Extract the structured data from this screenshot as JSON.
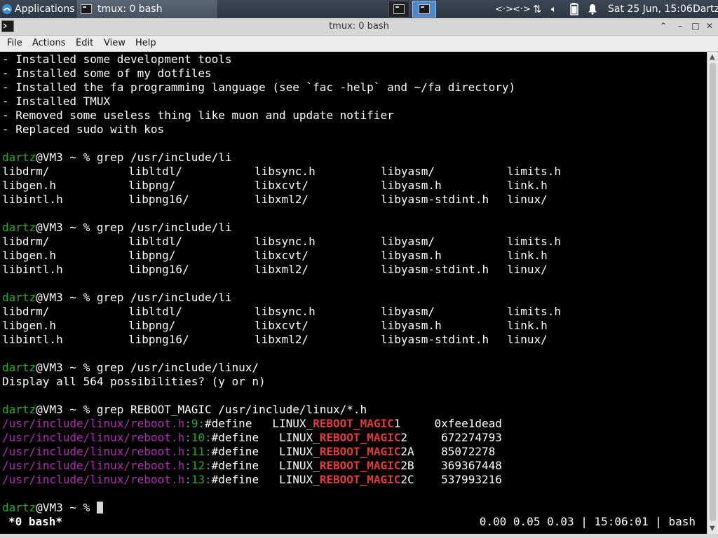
{
  "panel": {
    "applications": "Applications",
    "task_title": "tmux: 0 bash",
    "clock": "Sat 25 Jun, 15:06",
    "user": "Dartz",
    "tray_icons": [
      "network-icon",
      "network-icon",
      "transfer-icon",
      "volume-icon",
      "battery-icon",
      "notification-bell-icon"
    ]
  },
  "window": {
    "title": "tmux: 0 bash",
    "menus": [
      "File",
      "Actions",
      "Edit",
      "View",
      "Help"
    ]
  },
  "colors": {
    "prompt": "#27a827",
    "path": "#b02ab0",
    "linenum": "#27a8a8",
    "match": "#e23a3a"
  },
  "terminal": {
    "notes": [
      "- Installed some development tools",
      "- Installed some of my dotfiles",
      "- Installed the fa programming language (see `fac -help` and ~/fa directory)",
      "- Installed TMUX",
      "- Removed some useless thing like muon and update notifier",
      "- Replaced sudo with kos"
    ],
    "prompt_user": "dartz",
    "prompt_rest": "@VM3 ~ % ",
    "cmd_grep_li": "grep /usr/include/li",
    "listing": [
      [
        "libdrm/",
        "libltdl/",
        "libsync.h",
        "libyasm/",
        "limits.h"
      ],
      [
        "libgen.h",
        "libpng/",
        "libxcvt/",
        "libyasm.h",
        "link.h"
      ],
      [
        "libintl.h",
        "libpng16/",
        "libxml2/",
        "libyasm-stdint.h",
        "linux/"
      ]
    ],
    "cmd_grep_linux": "grep /usr/include/linux/",
    "possibilities": "Display all 564 possibilities? (y or n)",
    "cmd_grep_reboot": "grep REBOOT_MAGIC /usr/include/linux/*.h",
    "results": [
      {
        "path": "/usr/include/linux/reboot.h",
        "line": "9",
        "pre": "#define   LINUX_",
        "match": "REBOOT_MAGIC",
        "post": "1     0xfee1dead"
      },
      {
        "path": "/usr/include/linux/reboot.h",
        "line": "10",
        "pre": "#define   LINUX_",
        "match": "REBOOT_MAGIC",
        "post": "2     672274793"
      },
      {
        "path": "/usr/include/linux/reboot.h",
        "line": "11",
        "pre": "#define   LINUX_",
        "match": "REBOOT_MAGIC",
        "post": "2A    85072278"
      },
      {
        "path": "/usr/include/linux/reboot.h",
        "line": "12",
        "pre": "#define   LINUX_",
        "match": "REBOOT_MAGIC",
        "post": "2B    369367448"
      },
      {
        "path": "/usr/include/linux/reboot.h",
        "line": "13",
        "pre": "#define   LINUX_",
        "match": "REBOOT_MAGIC",
        "post": "2C    537993216"
      }
    ]
  },
  "tmux_status": {
    "window": "*0 bash*",
    "info": "0.00 0.05 0.03 | 15:06:01 | bash"
  }
}
